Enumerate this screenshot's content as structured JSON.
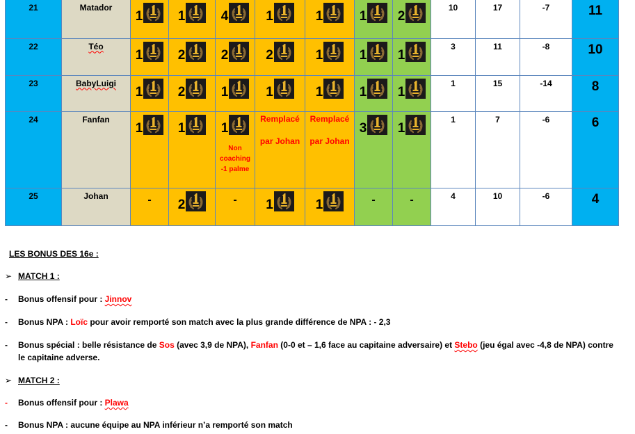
{
  "table": {
    "rows": [
      {
        "rank": "21",
        "name": "Matador",
        "name_spellcheck": false,
        "matches": [
          {
            "type": "palm",
            "count": "1",
            "color": "orange"
          },
          {
            "type": "palm",
            "count": "1",
            "color": "orange"
          },
          {
            "type": "palm",
            "count": "4",
            "color": "orange"
          },
          {
            "type": "palm",
            "count": "1",
            "color": "orange"
          },
          {
            "type": "palm",
            "count": "1",
            "color": "orange"
          },
          {
            "type": "palm",
            "count": "1",
            "color": "green"
          },
          {
            "type": "palm",
            "count": "2",
            "color": "green"
          }
        ],
        "stats": [
          "10",
          "17",
          "-7"
        ],
        "total": "11"
      },
      {
        "rank": "22",
        "name": "Téo",
        "name_spellcheck": true,
        "matches": [
          {
            "type": "palm",
            "count": "1",
            "color": "orange"
          },
          {
            "type": "palm",
            "count": "2",
            "color": "orange"
          },
          {
            "type": "palm",
            "count": "2",
            "color": "orange"
          },
          {
            "type": "palm",
            "count": "2",
            "color": "orange"
          },
          {
            "type": "palm",
            "count": "1",
            "color": "orange"
          },
          {
            "type": "palm",
            "count": "1",
            "color": "green"
          },
          {
            "type": "palm",
            "count": "1",
            "color": "green"
          }
        ],
        "stats": [
          "3",
          "11",
          "-8"
        ],
        "total": "10"
      },
      {
        "rank": "23",
        "name": "BabyLuigi",
        "name_spellcheck": true,
        "matches": [
          {
            "type": "palm",
            "count": "1",
            "color": "orange"
          },
          {
            "type": "palm",
            "count": "2",
            "color": "orange"
          },
          {
            "type": "palm",
            "count": "1",
            "color": "orange"
          },
          {
            "type": "palm",
            "count": "1",
            "color": "orange"
          },
          {
            "type": "palm",
            "count": "1",
            "color": "orange"
          },
          {
            "type": "palm",
            "count": "1",
            "color": "green"
          },
          {
            "type": "palm",
            "count": "1",
            "color": "green"
          }
        ],
        "stats": [
          "1",
          "15",
          "-14"
        ],
        "total": "8"
      },
      {
        "rank": "24",
        "name": "Fanfan",
        "name_spellcheck": false,
        "matches": [
          {
            "type": "palm",
            "count": "1",
            "color": "orange"
          },
          {
            "type": "palm",
            "count": "1",
            "color": "orange"
          },
          {
            "type": "palm",
            "count": "1",
            "color": "orange",
            "note": [
              "Non",
              "coaching",
              "-1 palme"
            ]
          },
          {
            "type": "replaced",
            "lines": [
              "Remplacé",
              "par Johan"
            ],
            "color": "orange"
          },
          {
            "type": "replaced",
            "lines": [
              "Remplacé",
              "par Johan"
            ],
            "color": "orange"
          },
          {
            "type": "palm",
            "count": "3",
            "color": "green"
          },
          {
            "type": "palm",
            "count": "1",
            "color": "green"
          }
        ],
        "stats": [
          "1",
          "7",
          "-6"
        ],
        "total": "6"
      },
      {
        "rank": "25",
        "name": "Johan",
        "name_spellcheck": false,
        "matches": [
          {
            "type": "dash",
            "text": "-",
            "color": "orange"
          },
          {
            "type": "palm",
            "count": "2",
            "color": "orange"
          },
          {
            "type": "dash",
            "text": "-",
            "color": "orange"
          },
          {
            "type": "palm",
            "count": "1",
            "color": "orange"
          },
          {
            "type": "palm",
            "count": "1",
            "color": "orange"
          },
          {
            "type": "dash",
            "text": "-",
            "color": "green"
          },
          {
            "type": "dash",
            "text": "-",
            "color": "green"
          }
        ],
        "stats": [
          "4",
          "10",
          "-6"
        ],
        "total": "4"
      }
    ],
    "badge_icon": "laurel-first-place-icon",
    "colors": {
      "rank": "#00b0f0",
      "name": "#ddd9c4",
      "orange": "#ffc000",
      "green": "#92d050",
      "total": "#00b0f0",
      "border": "#5b86bd",
      "highlight_text": "#ff0000"
    }
  },
  "bonus": {
    "heading": "LES BONUS DES 16e :",
    "match1": {
      "label": "MATCH 1 :",
      "offensive_prefix": "Bonus offensif pour : ",
      "offensive_name": "Jinnov",
      "npa_prefix": "Bonus NPA : ",
      "npa_name": "Loïc",
      "npa_suffix": " pour avoir remporté son match avec la plus grande différence de NPA : - 2,3",
      "special_prefix": "Bonus spécial : belle résistance de ",
      "special_name1": "Sos",
      "special_mid1": " (avec 3,9 de NPA), ",
      "special_name2": "Fanfan",
      "special_mid2": " (0-0 et – 1,6 face au capitaine adversaire) et ",
      "special_name3": "Stebo",
      "special_mid3": " (jeu égal avec -4,8 de NPA) contre",
      "special_line2": "le capitaine adverse."
    },
    "match2": {
      "label": "MATCH 2 :",
      "offensive_prefix": "Bonus offensif pour : ",
      "offensive_name": "Plawa",
      "npa_line": "Bonus NPA : aucune équipe au NPA inférieur n’a remporté son match"
    },
    "arrow_marker": "➢",
    "dash_marker": "-"
  }
}
